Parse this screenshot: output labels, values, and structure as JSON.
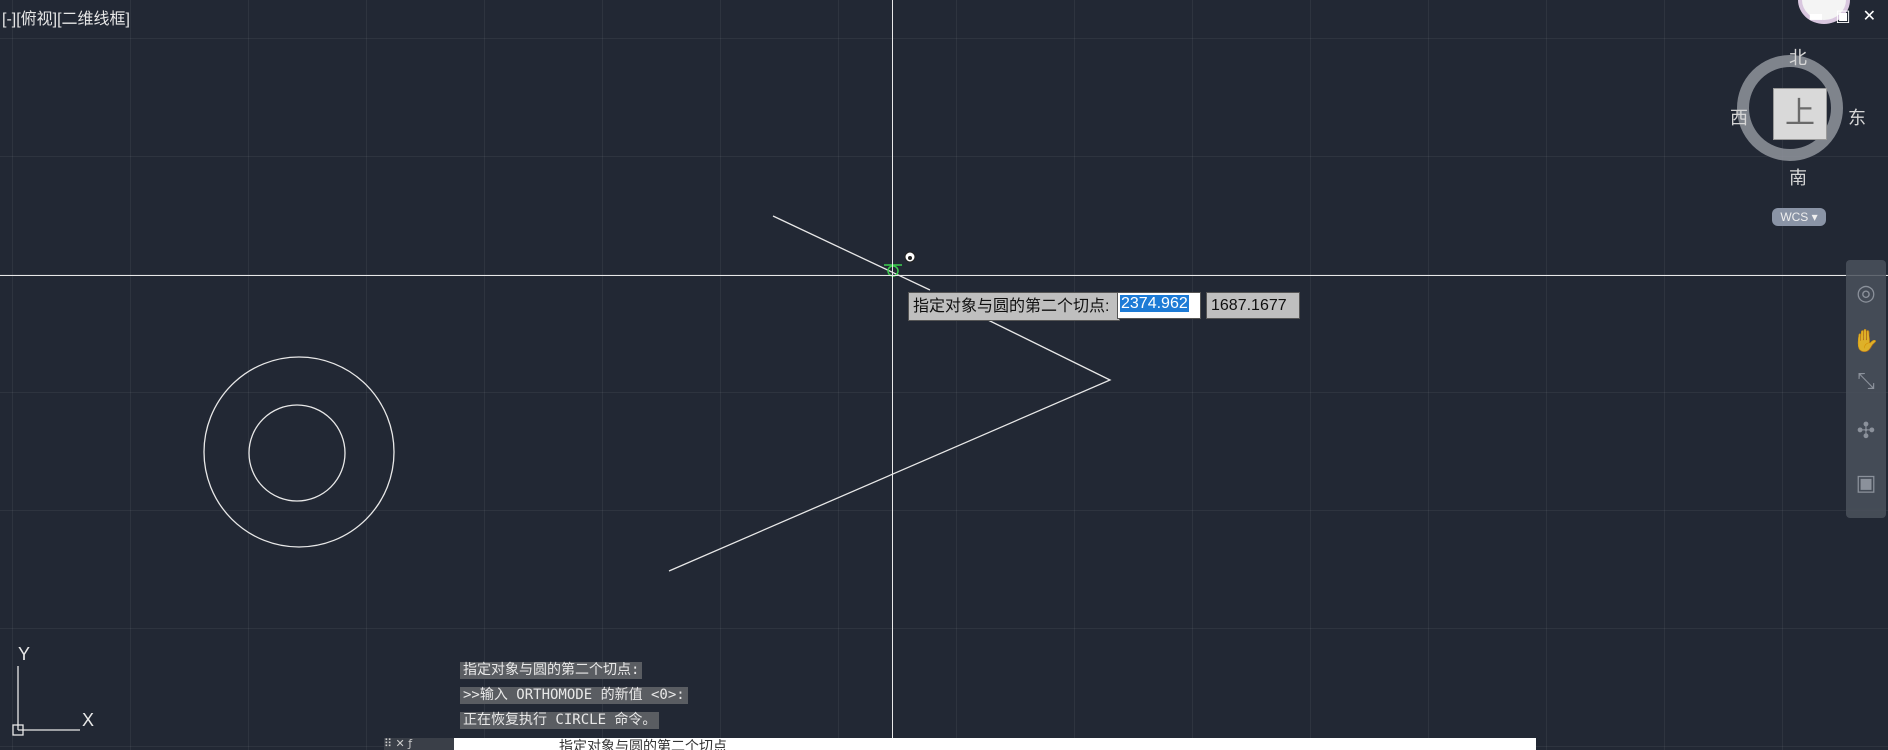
{
  "viewport": {
    "label": "[-][俯视][二维线框]"
  },
  "window_controls": {
    "minimize": "▬",
    "restore": "▣",
    "close": "✕"
  },
  "dynamic_input": {
    "prompt": "指定对象与圆的第二个切点:",
    "x_value": "2374.962",
    "y_value": "1687.1677"
  },
  "viewcube": {
    "north": "北",
    "south": "南",
    "east": "东",
    "west": "西",
    "face": "上",
    "coordinate_system": "WCS"
  },
  "navigation_bar": {
    "icons": [
      "steering-wheel-icon",
      "pan-hand-icon",
      "zoom-extents-icon",
      "orbit-icon",
      "showmotion-icon"
    ]
  },
  "ucs_icon": {
    "x_label": "X",
    "y_label": "Y"
  },
  "command_history": [
    "指定对象与圆的第二个切点:",
    ">>输入 ORTHOMODE 的新值 <0>:",
    "正在恢复执行 CIRCLE 命令。"
  ],
  "command_line": {
    "partial_text": "指定对象与圆的第二个切点"
  },
  "colors": {
    "background": "#222834",
    "grid": "#2e3542",
    "geometry": "#e8e8e8",
    "selection": "#1d7bd6",
    "snap_marker": "#3ccf4e"
  }
}
